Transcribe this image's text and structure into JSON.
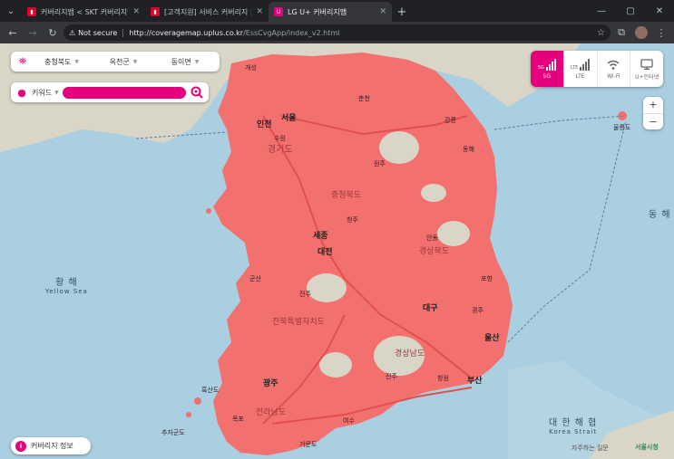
{
  "tabs": [
    {
      "title": "커버리지맵 < SKT 커버리지맵",
      "favicon_color": "#e4002b",
      "active": false
    },
    {
      "title": "[고객지원] 서비스 커버리지 | KT",
      "favicon_color": "#e4002b",
      "active": false
    },
    {
      "title": "LG U+ 커버리지맵",
      "favicon_color": "#e6007e",
      "active": true
    }
  ],
  "omnibox": {
    "security_label": "Not secure",
    "url_host": "http://coveragemap.uplus.co.kr",
    "url_path": "/EssCvgApp/index_v2.html"
  },
  "region": {
    "province": "충청북도",
    "district": "옥천군",
    "town": "동이면"
  },
  "keyword": {
    "type_label": "키워드",
    "value": ""
  },
  "networks": [
    {
      "label": "5G",
      "badge": "5G",
      "active": true
    },
    {
      "label": "LTE",
      "badge": "LTE",
      "active": false
    },
    {
      "label": "Wi-Fi",
      "badge": "",
      "active": false
    },
    {
      "label": "U+인터넷",
      "badge": "",
      "active": false
    }
  ],
  "zoom": {
    "in": "+",
    "out": "−"
  },
  "coverage_info_label": "커버리지 정보",
  "seas": {
    "yellow_ko": "황 해",
    "yellow_en": "Yellow Sea",
    "strait_ko": "대 한 해 협",
    "strait_en": "Korea Strait",
    "east_ko": "동 해"
  },
  "places": {
    "seoul": "서울",
    "incheon": "인천",
    "sejong": "세종",
    "daejeon": "대전",
    "daegu": "대구",
    "gwangju": "광주",
    "ulsan": "울산",
    "busan": "부산",
    "gaeseong": "개성",
    "gangneung": "강릉",
    "donghae": "동해",
    "pohang": "포항",
    "gyeongju": "경주",
    "changwon": "창원",
    "jinju": "진주",
    "jeonju": "전주",
    "cheongju": "청주",
    "andong": "안동",
    "wonju": "원주",
    "suwon": "수원",
    "gunsan": "군산",
    "mokpo": "목포",
    "yeosu": "여수",
    "chuncheon": "춘천",
    "chungbuk": "충청북도",
    "gyeongbuk": "경상북도",
    "gyeonggi": "경기도",
    "jeonnam": "전라남도",
    "jeonbuk": "전북특별자치도",
    "gyeongnam": "경상남도",
    "ulleung": "울릉도",
    "heuksan": "흑산도",
    "geomun": "거문도",
    "chuja": "추자군도"
  },
  "footer": {
    "text": "자주하는 질문",
    "logo": "서울시청"
  },
  "colors": {
    "coverage": "#f2706e",
    "accent": "#e6007e",
    "land": "#d9d6c8",
    "sea": "#a9cfe0"
  }
}
